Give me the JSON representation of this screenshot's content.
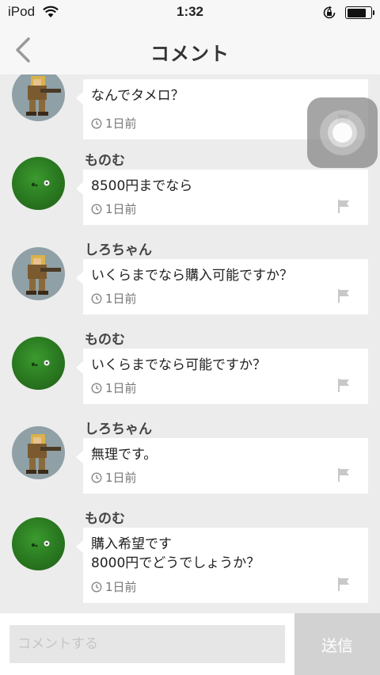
{
  "status_bar": {
    "carrier": "iPod",
    "time": "1:32"
  },
  "header": {
    "title": "コメント"
  },
  "comments": [
    {
      "user": "",
      "avatar": "soldier",
      "lines": [
        "なんでタメロ？"
      ],
      "time": "1日前"
    },
    {
      "user": "ものむ",
      "avatar": "green",
      "lines": [
        "8500円までなら"
      ],
      "time": "1日前"
    },
    {
      "user": "しろちゃん",
      "avatar": "soldier",
      "lines": [
        "いくらまでなら購入可能ですか？"
      ],
      "time": "1日前"
    },
    {
      "user": "ものむ",
      "avatar": "green",
      "lines": [
        "いくらまでなら可能ですか？"
      ],
      "time": "1日前"
    },
    {
      "user": "しろちゃん",
      "avatar": "soldier",
      "lines": [
        "無理です。"
      ],
      "time": "1日前"
    },
    {
      "user": "ものむ",
      "avatar": "green",
      "lines": [
        "購入希望です",
        "8000円でどうでしょうか？"
      ],
      "time": "1日前"
    }
  ],
  "input": {
    "placeholder": "コメントする",
    "value": ""
  },
  "send_label": "送信",
  "icons": {
    "back": "chevron-left-icon",
    "clock": "clock-icon",
    "flag": "flag-icon",
    "wifi": "wifi-icon",
    "rotation_lock": "rotation-lock-icon",
    "battery": "battery-icon"
  },
  "colors": {
    "background": "#ececec",
    "bar": "#f7f7f7",
    "bubble": "#ffffff",
    "send_button": "#d2d2d2"
  }
}
